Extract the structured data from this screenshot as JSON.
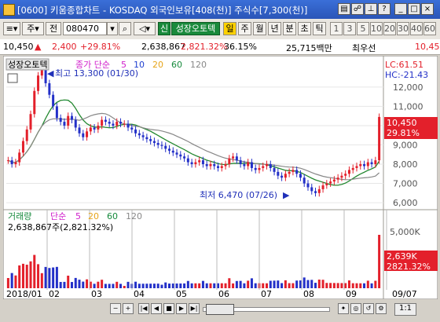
{
  "window": {
    "title": "[0600] 키움종합차트 - KOSDAQ 외국인보유[408(천)] 주식수[7,300(천)]"
  },
  "toolbar": {
    "market_label": "주",
    "range_label": "전",
    "stock_code": "080470",
    "stock_name": "성장오토텍",
    "badge_label": "신",
    "period_tabs": [
      "일",
      "주",
      "월",
      "년",
      "분",
      "초",
      "틱"
    ],
    "active_period": "일",
    "interval_options": [
      "1",
      "3",
      "5",
      "10",
      "20",
      "30",
      "40",
      "60"
    ]
  },
  "quote": {
    "price": "10,450",
    "change": "2,400",
    "change_pct": "+29.81%",
    "volume": "2,638,867",
    "volume_ratio": "2,821.32%",
    "rate": "36.15%",
    "amount": "25,715백만",
    "preferred_label": "최우선",
    "right_price": "10,45"
  },
  "chart_panel": {
    "stock_label": "성장오토텍",
    "ma_label": "종가 단순",
    "ma_periods": [
      "5",
      "10",
      "20",
      "60",
      "120"
    ],
    "ma_colors": [
      "#d01ecb",
      "#1f3fd0",
      "#e6a41a",
      "#168a3c",
      "#888888"
    ],
    "lc_label": "LC:61.51",
    "hc_label": "HC:-21.43",
    "high_annotation": "최고 13,300 (01/30)",
    "low_annotation": "최저 6,470 (07/26)",
    "current_price_tag": "10,450",
    "current_pct_tag": "29.81%",
    "up_color": "#e3202b",
    "down_color": "#2330c8"
  },
  "volume_panel": {
    "label": "거래량",
    "ma_label": "단순",
    "ma_periods": [
      "5",
      "20",
      "60",
      "120"
    ],
    "volume_text": "2,638,867주(2,821.32%)",
    "volume_tag": "2,639K",
    "volume_pct_tag": "2821.32%"
  },
  "chart_data": {
    "type": "candlestick",
    "x_ticks": [
      "2018/01",
      "02",
      "03",
      "04",
      "05",
      "06",
      "07",
      "08",
      "09",
      "09/07"
    ],
    "price_ylim": [
      5800,
      13300
    ],
    "price_ticks": [
      12000,
      11000,
      10000,
      9000,
      8000,
      7000,
      6000
    ],
    "volume_ylim": [
      0,
      6000
    ],
    "volume_ticks": [
      "5,000K"
    ],
    "close_series": [
      8200,
      8000,
      8100,
      8600,
      9200,
      9800,
      10600,
      11800,
      12600,
      12900,
      12200,
      11600,
      11000,
      10400,
      10200,
      10000,
      10500,
      10300,
      9900,
      9600,
      9400,
      9700,
      9900,
      9800,
      10000,
      10300,
      10200,
      10100,
      10000,
      10200,
      10100,
      10100,
      9900,
      9800,
      9600,
      9500,
      9400,
      9300,
      9200,
      9100,
      9000,
      8950,
      8800,
      8700,
      8600,
      8500,
      8400,
      8300,
      8100,
      8000,
      8100,
      8200,
      8000,
      7900,
      8000,
      7900,
      7800,
      7900,
      8000,
      8300,
      8400,
      8200,
      8000,
      7900,
      8100,
      7800,
      7700,
      7800,
      7900,
      8000,
      7800,
      7600,
      7400,
      7300,
      7500,
      7600,
      7700,
      7500,
      7300,
      7000,
      6800,
      6600,
      6500,
      6700,
      6900,
      7000,
      7100,
      7200,
      7300,
      7400,
      7500,
      7700,
      7800,
      7900,
      8000,
      7900,
      8100,
      8000,
      8200,
      10450
    ],
    "low_point": {
      "label": "6,470",
      "date": "07/26"
    },
    "high_point": {
      "label": "13,300",
      "date": "01/30"
    }
  },
  "bottom": {
    "label": "1:1"
  }
}
